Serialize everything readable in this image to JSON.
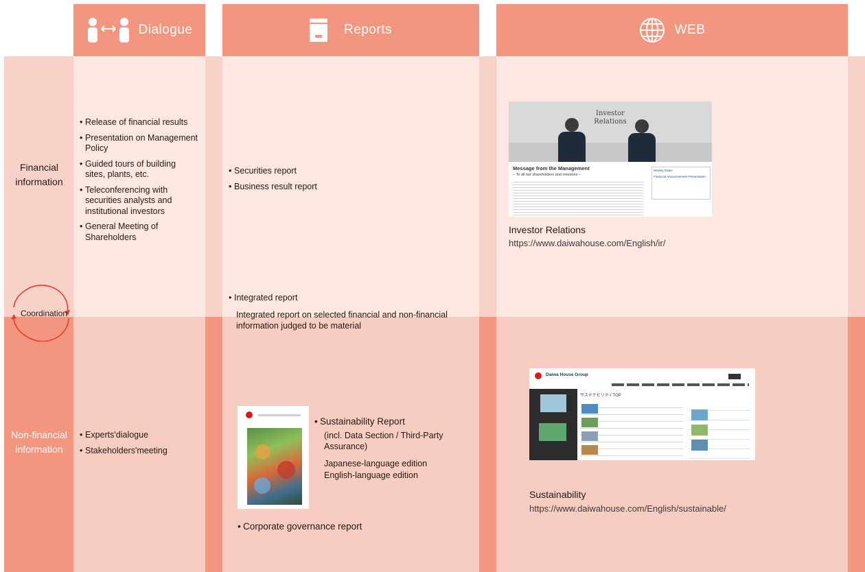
{
  "header": {
    "dialogue_label": "Dialogue",
    "reports_label": "Reports",
    "web_label": "WEB",
    "dialogue_icon": "two-people-exchange-icon",
    "reports_icon": "document-icon",
    "web_icon": "globe-icon"
  },
  "rows": {
    "financial_label": "Financial information",
    "nonfinancial_label": "Non-financial information",
    "coordination_label": "Coordination"
  },
  "financial": {
    "dialogue_items": [
      "Release of financial results",
      "Presentation on Management Policy",
      "Guided tours of building sites, plants, etc.",
      "Teleconferencing with securities analysts and institutional investors",
      "General Meeting of Shareholders"
    ],
    "report_items": [
      "Securities report",
      "Business result report"
    ],
    "web_title": "Investor Relations",
    "web_url": "https://www.daiwahouse.com/English/ir/",
    "web_screenshot": {
      "title": "Investor Relations",
      "heading": "Message from the Management",
      "subheading": "– To all our shareholders and investors –",
      "side_title": "Weekly Dates",
      "side_item": "Financial Announcement Presentation"
    }
  },
  "integrated": {
    "item": "Integrated report",
    "description": "Integrated report on selected financial and non-financial information judged to be material"
  },
  "nonfinancial": {
    "dialogue_items": [
      "Experts'dialogue",
      "Stakeholders'meeting"
    ],
    "report_item": "Sustainability Report",
    "report_details": [
      "(incl. Data Section / Third-Party Assurance)",
      "Japanese-language edition",
      "English-language edition"
    ],
    "governance_item": "Corporate governance report",
    "web_title": "Sustainability",
    "web_url": "https://www.daiwahouse.com/English/sustainable/",
    "web_screenshot": {
      "brand": "Daiwa House Group",
      "title": "サステナビリティTOP"
    }
  },
  "colors": {
    "header": "#f3967f",
    "financial_dark": "#f8d2c8",
    "financial_light": "#fde8e1",
    "nonfinancial_dark": "#f3967f",
    "nonfinancial_light": "#f8cdc1",
    "coordination_arrow": "#e83a2a",
    "text": "#231815"
  }
}
